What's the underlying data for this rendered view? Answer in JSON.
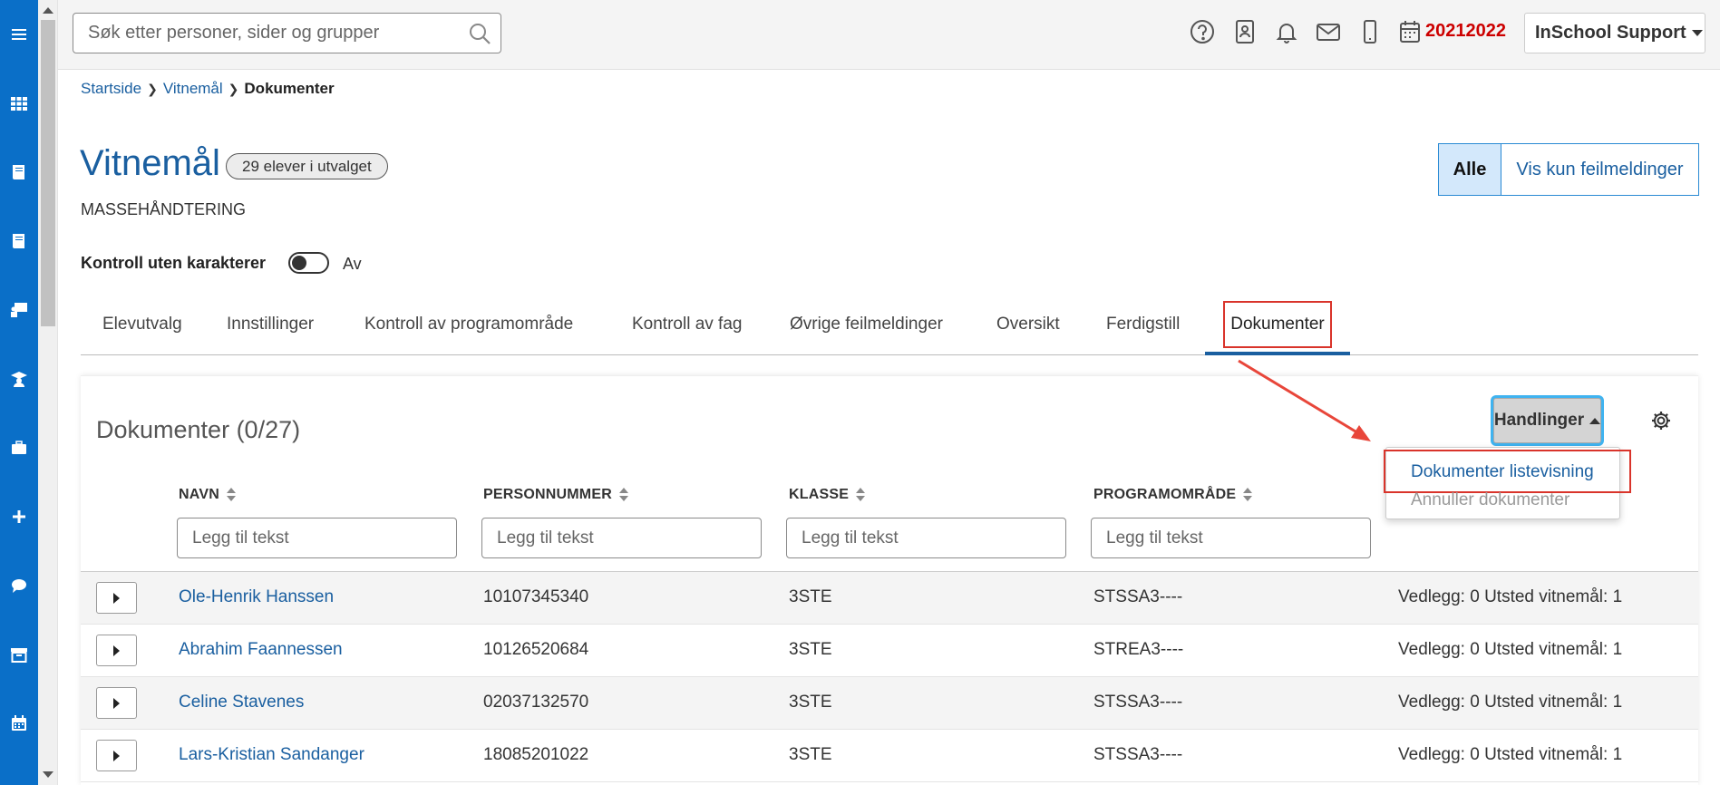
{
  "header": {
    "search_placeholder": "Søk etter personer, sider og grupper",
    "year": "20212022",
    "user_menu": "InSchool Support"
  },
  "sidebar": {
    "icons": [
      "menu-icon",
      "apps-grid-icon",
      "book-icon",
      "book-icon-2",
      "teacher-icon",
      "graduate-icon",
      "briefcase-icon",
      "plus-icon",
      "chat-icon",
      "archive-icon",
      "calendar-icon"
    ]
  },
  "breadcrumb": {
    "items": [
      "Startside",
      "Vitnemål"
    ],
    "current": "Dokumenter"
  },
  "page": {
    "title": "Vitnemål",
    "badge": "29 elever i utvalget",
    "subtitle": "MASSEHÅNDTERING",
    "filter_all": "Alle",
    "filter_errors": "Vis kun feilmeldinger",
    "toggle_label": "Kontroll uten karakterer",
    "toggle_state": "Av"
  },
  "tabs": [
    "Elevutvalg",
    "Innstillinger",
    "Kontroll av programområde",
    "Kontroll av fag",
    "Øvrige feilmeldinger",
    "Oversikt",
    "Ferdigstill",
    "Dokumenter"
  ],
  "panel": {
    "title": "Dokumenter (0/27)",
    "actions_label": "Handlinger",
    "menu": {
      "item1": "Dokumenter listevisning",
      "item2": "Annuller dokumenter"
    },
    "columns": {
      "name": "NAVN",
      "ssn": "PERSONNUMMER",
      "class": "KLASSE",
      "program": "PROGRAMOMRÅDE"
    },
    "filter_placeholder": "Legg til tekst",
    "rows": [
      {
        "name": "Ole-Henrik Hanssen",
        "ssn": "10107345340",
        "class": "3STE",
        "program": "STSSA3----",
        "info": "Vedlegg: 0 Utsted vitnemål: 1"
      },
      {
        "name": "Abrahim Faannessen",
        "ssn": "10126520684",
        "class": "3STE",
        "program": "STREA3----",
        "info": "Vedlegg: 0 Utsted vitnemål: 1"
      },
      {
        "name": "Celine Stavenes",
        "ssn": "02037132570",
        "class": "3STE",
        "program": "STSSA3----",
        "info": "Vedlegg: 0 Utsted vitnemål: 1"
      },
      {
        "name": "Lars-Kristian Sandanger",
        "ssn": "18085201022",
        "class": "3STE",
        "program": "STSSA3----",
        "info": "Vedlegg: 0 Utsted vitnemål: 1"
      }
    ]
  },
  "colors": {
    "sidebar": "#0a6fc8",
    "link": "#1a5fa0",
    "highlight": "#d9342b",
    "year": "#cc0000"
  }
}
